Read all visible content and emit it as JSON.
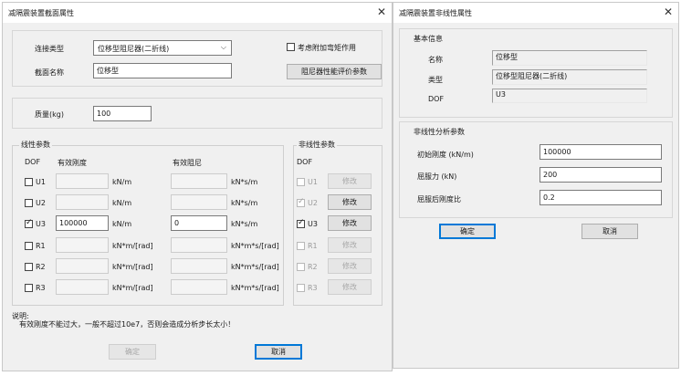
{
  "dialog1": {
    "title": "减隔震装置截面属性",
    "close": "✕",
    "link_type_label": "连接类型",
    "link_type_value": "位移型阻尼器(二折线)",
    "extra_moment_label": "考虑附加弯矩作用",
    "section_name_label": "截面名称",
    "section_name_value": "位移型",
    "damper_eval_button": "阻尼器性能评价参数",
    "mass_label": "质量(kg)",
    "mass_value": "100",
    "linear_group_title": "线性参数",
    "dof_header": "DOF",
    "eff_stiffness_header": "有效刚度",
    "eff_damping_header": "有效阻尼",
    "nonlinear_group_title": "非线性参数",
    "nonlinear_dof_header": "DOF",
    "rows": [
      {
        "dof": "U1",
        "stiff": "",
        "stiff_unit": "kN/m",
        "damp": "",
        "damp_unit": "kN*s/m",
        "checked": false,
        "nl_dof": "U1",
        "nl_checked": false,
        "edit": "修改"
      },
      {
        "dof": "U2",
        "stiff": "",
        "stiff_unit": "kN/m",
        "damp": "",
        "damp_unit": "kN*s/m",
        "checked": false,
        "nl_dof": "U2",
        "nl_checked": true,
        "edit": "修改"
      },
      {
        "dof": "U3",
        "stiff": "100000",
        "stiff_unit": "kN/m",
        "damp": "0",
        "damp_unit": "kN*s/m",
        "checked": true,
        "nl_dof": "U3",
        "nl_checked": true,
        "edit": "修改"
      },
      {
        "dof": "R1",
        "stiff": "",
        "stiff_unit": "kN*m/[rad]",
        "damp": "",
        "damp_unit": "kN*m*s/[rad]",
        "checked": false,
        "nl_dof": "R1",
        "nl_checked": false,
        "edit": "修改"
      },
      {
        "dof": "R2",
        "stiff": "",
        "stiff_unit": "kN*m/[rad]",
        "damp": "",
        "damp_unit": "kN*m*s/[rad]",
        "checked": false,
        "nl_dof": "R2",
        "nl_checked": false,
        "edit": "修改"
      },
      {
        "dof": "R3",
        "stiff": "",
        "stiff_unit": "kN*m/[rad]",
        "damp": "",
        "damp_unit": "kN*m*s/[rad]",
        "checked": false,
        "nl_dof": "R3",
        "nl_checked": false,
        "edit": "修改"
      }
    ],
    "note_title": "说明:",
    "note_text": "有效刚度不能过大，一般不超过10e7，否则会造成分析步长太小！",
    "ok_button": "确定",
    "cancel_button": "取消"
  },
  "dialog2": {
    "title": "减隔震装置非线性属性",
    "close": "✕",
    "basic_group_title": "基本信息",
    "name_label": "名称",
    "name_value": "位移型",
    "type_label": "类型",
    "type_value": "位移型阻尼器(二折线)",
    "dof_label": "DOF",
    "dof_value": "U3",
    "nl_group_title": "非线性分析参数",
    "init_stiff_label": "初始刚度 (kN/m)",
    "init_stiff_value": "100000",
    "yield_force_label": "屈服力 (kN)",
    "yield_force_value": "200",
    "post_yield_label": "屈服后刚度比",
    "post_yield_value": "0.2",
    "ok_button": "确定",
    "cancel_button": "取消"
  }
}
